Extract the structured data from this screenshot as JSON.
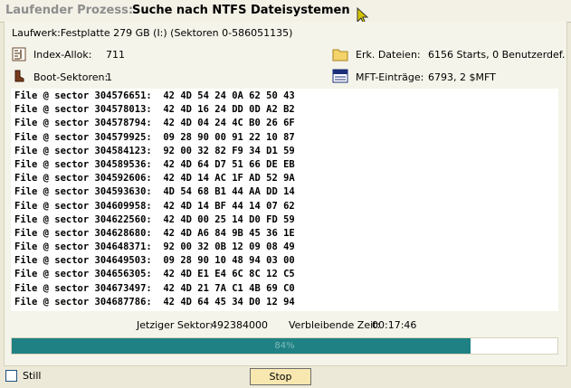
{
  "title": {
    "label": "Laufender Prozess:",
    "value": "Suche nach NTFS Dateisystemen"
  },
  "info": {
    "drive": "Laufwerk:Festplatte 279 GB (I:) (Sektoren 0-586051135)",
    "index_alloc_label": "Index-Allok:",
    "index_alloc_value": "711",
    "boot_sectors_label": "Boot-Sektoren:",
    "boot_sectors_value": "1",
    "found_files_label": "Erk. Dateien:",
    "found_files_value": "6156 Starts, 0 Benutzerdef.",
    "mft_label": "MFT-Einträge:",
    "mft_value": "6793, 2 $MFT"
  },
  "icons": {
    "index_alloc": "index-allocation-icon",
    "boot_sectors": "boot-sector-icon",
    "found_files": "folder-icon",
    "mft": "file-mft-icon"
  },
  "log_lines": [
    "File @ sector 304576651:  42 4D 54 24 0A 62 50 43",
    "File @ sector 304578013:  42 4D 16 24 DD 0D A2 B2",
    "File @ sector 304578794:  42 4D 04 24 4C B0 26 6F",
    "File @ sector 304579925:  09 28 90 00 91 22 10 87",
    "File @ sector 304584123:  92 00 32 82 F9 34 D1 59",
    "File @ sector 304589536:  42 4D 64 D7 51 66 DE EB",
    "File @ sector 304592606:  42 4D 14 AC 1F AD 52 9A",
    "File @ sector 304593630:  4D 54 68 B1 44 AA DD 14",
    "File @ sector 304609958:  42 4D 14 BF 44 14 07 62",
    "File @ sector 304622560:  42 4D 00 25 14 D0 FD 59",
    "File @ sector 304628680:  42 4D A6 84 9B 45 36 1E",
    "File @ sector 304648371:  92 00 32 0B 12 09 08 49",
    "File @ sector 304649503:  09 28 90 10 48 94 03 00",
    "File @ sector 304656305:  42 4D E1 E4 6C 8C 12 C5",
    "File @ sector 304673497:  42 4D 21 7A C1 4B 69 C0",
    "File @ sector 304687786:  42 4D 64 45 34 D0 12 94"
  ],
  "status": {
    "current_sector_label": "Jetziger Sektor:",
    "current_sector_value": "492384000",
    "remaining_label": "Verbleibende Zeit:",
    "remaining_value": "00:17:46"
  },
  "progress": {
    "percent": 84,
    "text": "84%"
  },
  "footer": {
    "still_label": "Still",
    "stop_label": "Stop"
  },
  "colors": {
    "progress": "#1f8183",
    "stop_button": "#f8e8b0",
    "title_gray": "#8e8e8e"
  }
}
